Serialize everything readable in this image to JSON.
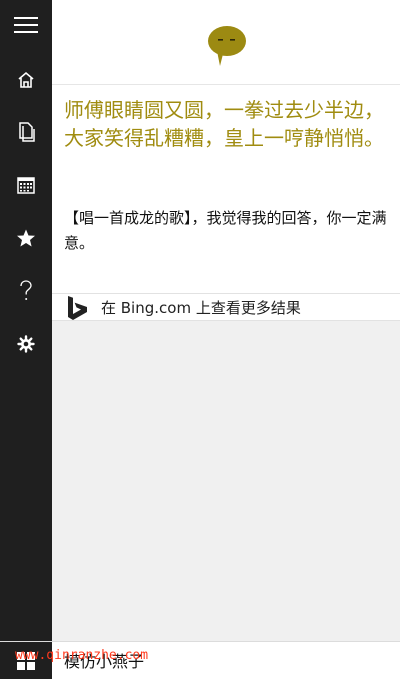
{
  "answer": {
    "text": "师傅眼睛圆又圆，一拳过去少半边，大家笑得乱糟糟，皇上一哼静悄悄。",
    "subtext": "【唱一首成龙的歌】，我觉得我的回答，你一定满意。"
  },
  "bing": {
    "label": "在 Bing.com 上查看更多结果"
  },
  "search": {
    "query": "模仿小燕子"
  },
  "watermark": {
    "text": "www.qinranzhe.com"
  },
  "sidebar": {
    "items": [
      {
        "icon": "hamburger-menu-icon"
      },
      {
        "icon": "home-icon"
      },
      {
        "icon": "notebook-icon"
      },
      {
        "icon": "calendar-icon"
      },
      {
        "icon": "star-icon"
      },
      {
        "icon": "help-icon"
      },
      {
        "icon": "gear-icon"
      }
    ]
  },
  "colors": {
    "sidebar": "#1f1f1f",
    "answer_text": "#a08c10",
    "logo": "#9c8a12",
    "content_bg": "#f0f0f0",
    "watermark": "#ff3a1e"
  }
}
